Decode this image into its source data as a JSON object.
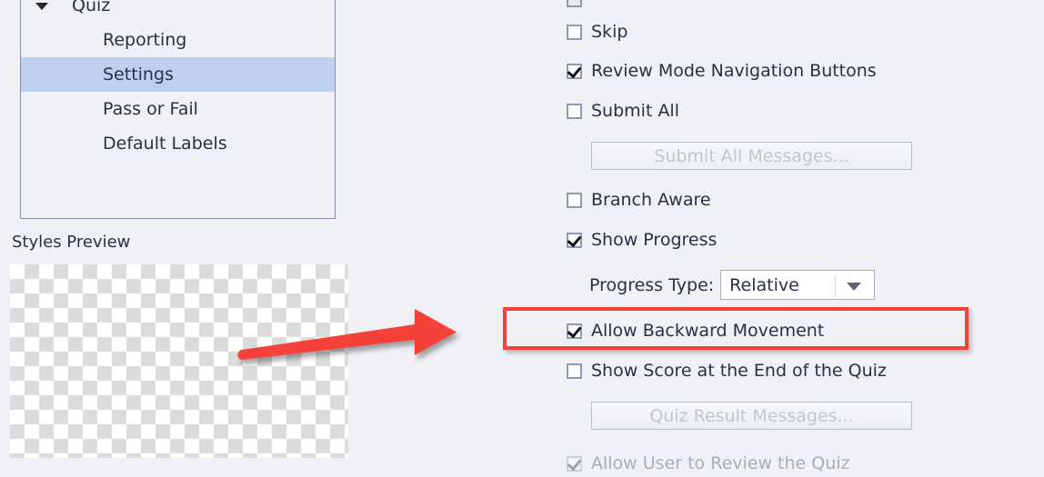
{
  "background_color": "#eff1f6",
  "accent_color": "#f4423a",
  "selection_color": "#bdd0ef",
  "left_panel": {
    "tree": {
      "root": {
        "label": "Quiz",
        "expanded_icon": "caret-down-icon"
      },
      "children": [
        {
          "label": "Reporting",
          "selected": false
        },
        {
          "label": "Settings",
          "selected": true
        },
        {
          "label": "Pass or Fail",
          "selected": false
        },
        {
          "label": "Default Labels",
          "selected": false
        }
      ]
    },
    "styles_preview_label": "Styles Preview"
  },
  "right_panel": {
    "options": [
      {
        "label": "Skip",
        "checked": false,
        "indent": 0
      },
      {
        "label": "Review Mode Navigation Buttons",
        "checked": true,
        "indent": 0
      },
      {
        "label": "Submit All",
        "checked": false,
        "indent": 0
      },
      {
        "label": "Branch Aware",
        "checked": false,
        "indent": 0
      },
      {
        "label": "Show Progress",
        "checked": true,
        "indent": 0
      },
      {
        "label": "Allow Backward Movement",
        "checked": true,
        "indent": 1
      },
      {
        "label": "Show Score at the End of the Quiz",
        "checked": false,
        "indent": 1
      }
    ],
    "buttons": [
      {
        "label": "Submit All Messages...",
        "disabled": true
      },
      {
        "label": "Quiz Result Messages...",
        "disabled": true
      }
    ],
    "progress_type": {
      "label": "Progress Type:",
      "value": "Relative",
      "arrow_icon": "chevron-down-icon"
    },
    "clipped_bottom_label": "Allow User to Review the Quiz"
  },
  "annotations": {
    "arrow": {
      "icon": "right-arrow-annotation",
      "color": "#f4423a"
    },
    "highlight": {
      "icon": "rectangle-highlight-annotation",
      "color": "#f4423a"
    }
  }
}
